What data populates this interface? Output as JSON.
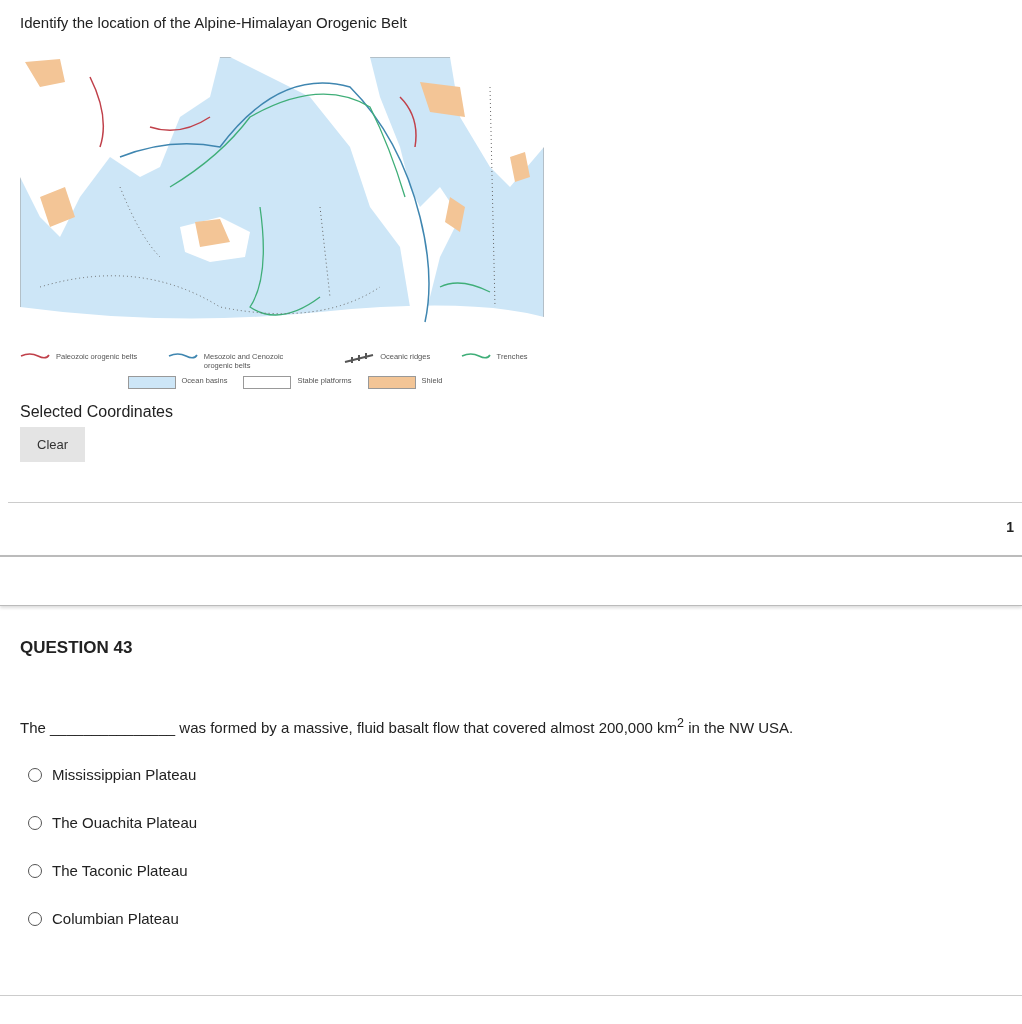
{
  "prompt": "Identify the location of the Alpine-Himalayan Orogenic Belt",
  "legend": [
    {
      "kind": "line",
      "color": "#c0404a",
      "label": "Paleozoic orogenic belts"
    },
    {
      "kind": "line",
      "color": "#3f86b0",
      "label": "Mesozoic and Cenozoic orogenic belts"
    },
    {
      "kind": "ridge",
      "color": "#555555",
      "label": "Oceanic ridges"
    },
    {
      "kind": "line",
      "color": "#3fae78",
      "label": "Trenches"
    },
    {
      "kind": "fill",
      "color": "#cde6f7",
      "label": "Ocean basins"
    },
    {
      "kind": "fill",
      "color": "#ffffff",
      "label": "Stable platforms"
    },
    {
      "kind": "fill",
      "color": "#f3c596",
      "label": "Shield"
    }
  ],
  "selected_coordinates_label": "Selected Coordinates",
  "clear_button": "Clear",
  "points": "1",
  "question": {
    "heading": "QUESTION 43",
    "text": "The _______________ was formed by a massive, fluid basalt flow that covered almost 200,000 km$^{2}$ in the NW USA.",
    "options": [
      {
        "label": "Mississippian Plateau",
        "selected": false
      },
      {
        "label": "The Ouachita Plateau",
        "selected": false
      },
      {
        "label": "The Taconic Plateau",
        "selected": false
      },
      {
        "label": "Columbian Plateau",
        "selected": false
      }
    ]
  }
}
